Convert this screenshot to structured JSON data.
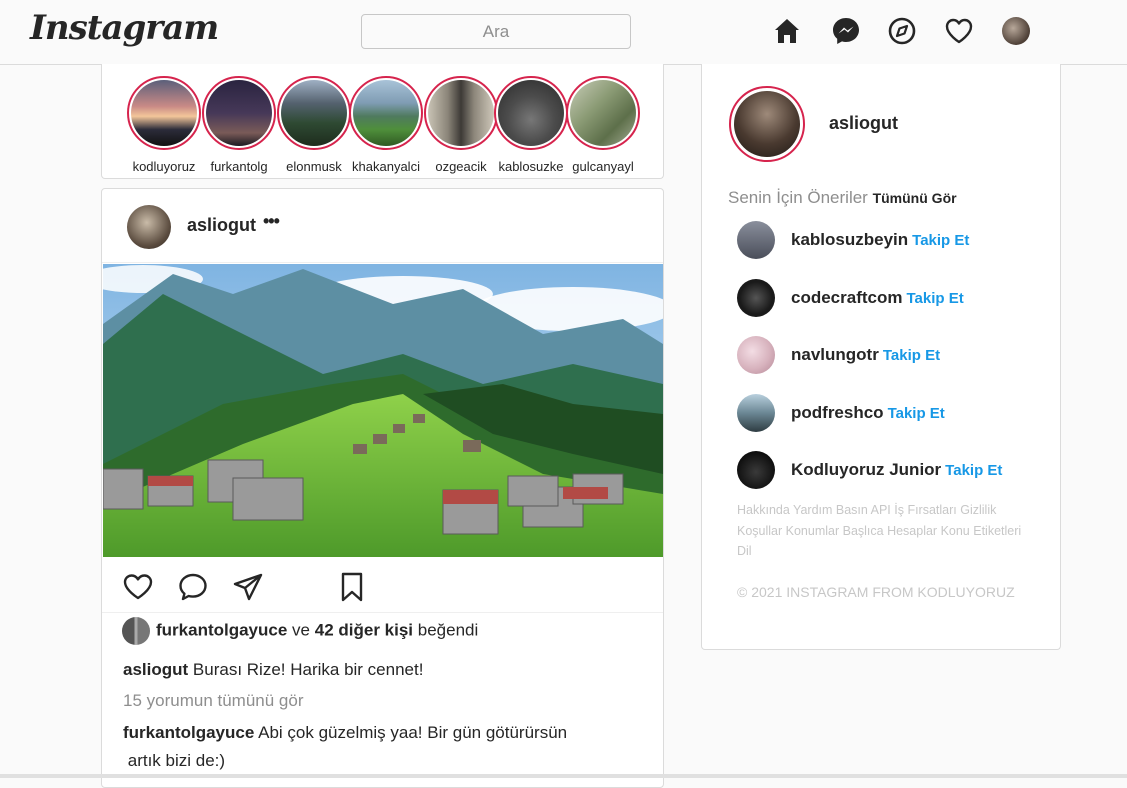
{
  "header": {
    "logo": "Instagram",
    "search_placeholder": "Ara",
    "nav_icons": [
      "home-icon",
      "messenger-icon",
      "explore-icon",
      "heart-icon"
    ]
  },
  "stories": [
    {
      "name": "kodluyoruz"
    },
    {
      "name": "furkantolg"
    },
    {
      "name": "elonmusk"
    },
    {
      "name": "khakanyalci"
    },
    {
      "name": "ozgeacik"
    },
    {
      "name": "kablosuzke"
    },
    {
      "name": "gulcanyayl"
    }
  ],
  "post": {
    "username": "asliogut",
    "more": "•••",
    "likes": {
      "user": "furkantolgayuce",
      "connector": "ve",
      "others": "42 diğer kişi",
      "suffix": "beğendi"
    },
    "caption": {
      "user": "asliogut",
      "text": "Burası Rize! Harika bir cennet!"
    },
    "view_comments": "15 yorumun tümünü gör",
    "comment": {
      "user": "furkantolgayuce",
      "text_line1": "Abi çok güzelmiş yaa! Bir gün götürürsün",
      "text_line2": "artık bizi de:)"
    }
  },
  "sidebar": {
    "me": "asliogut",
    "suggestions_title": "Senin İçin Öneriler",
    "see_all": "Tümünü Gör",
    "follow_label": "Takip Et",
    "suggestions": [
      {
        "name": "kablosuzbeyin"
      },
      {
        "name": "codecraftcom"
      },
      {
        "name": "navlungotr"
      },
      {
        "name": "podfreshco"
      },
      {
        "name": "Kodluyoruz Junior"
      }
    ],
    "footer_links": "Hakkında Yardım Basın API İş Fırsatları Gizlilik Koşullar Konumlar Başlıca Hesaplar Konu Etiketleri Dil",
    "copyright": "© 2021 INSTAGRAM FROM KODLUYORUZ"
  },
  "colors": {
    "story_ring": "#d6244d",
    "follow": "#1798e6",
    "muted": "#8e8e8e"
  }
}
